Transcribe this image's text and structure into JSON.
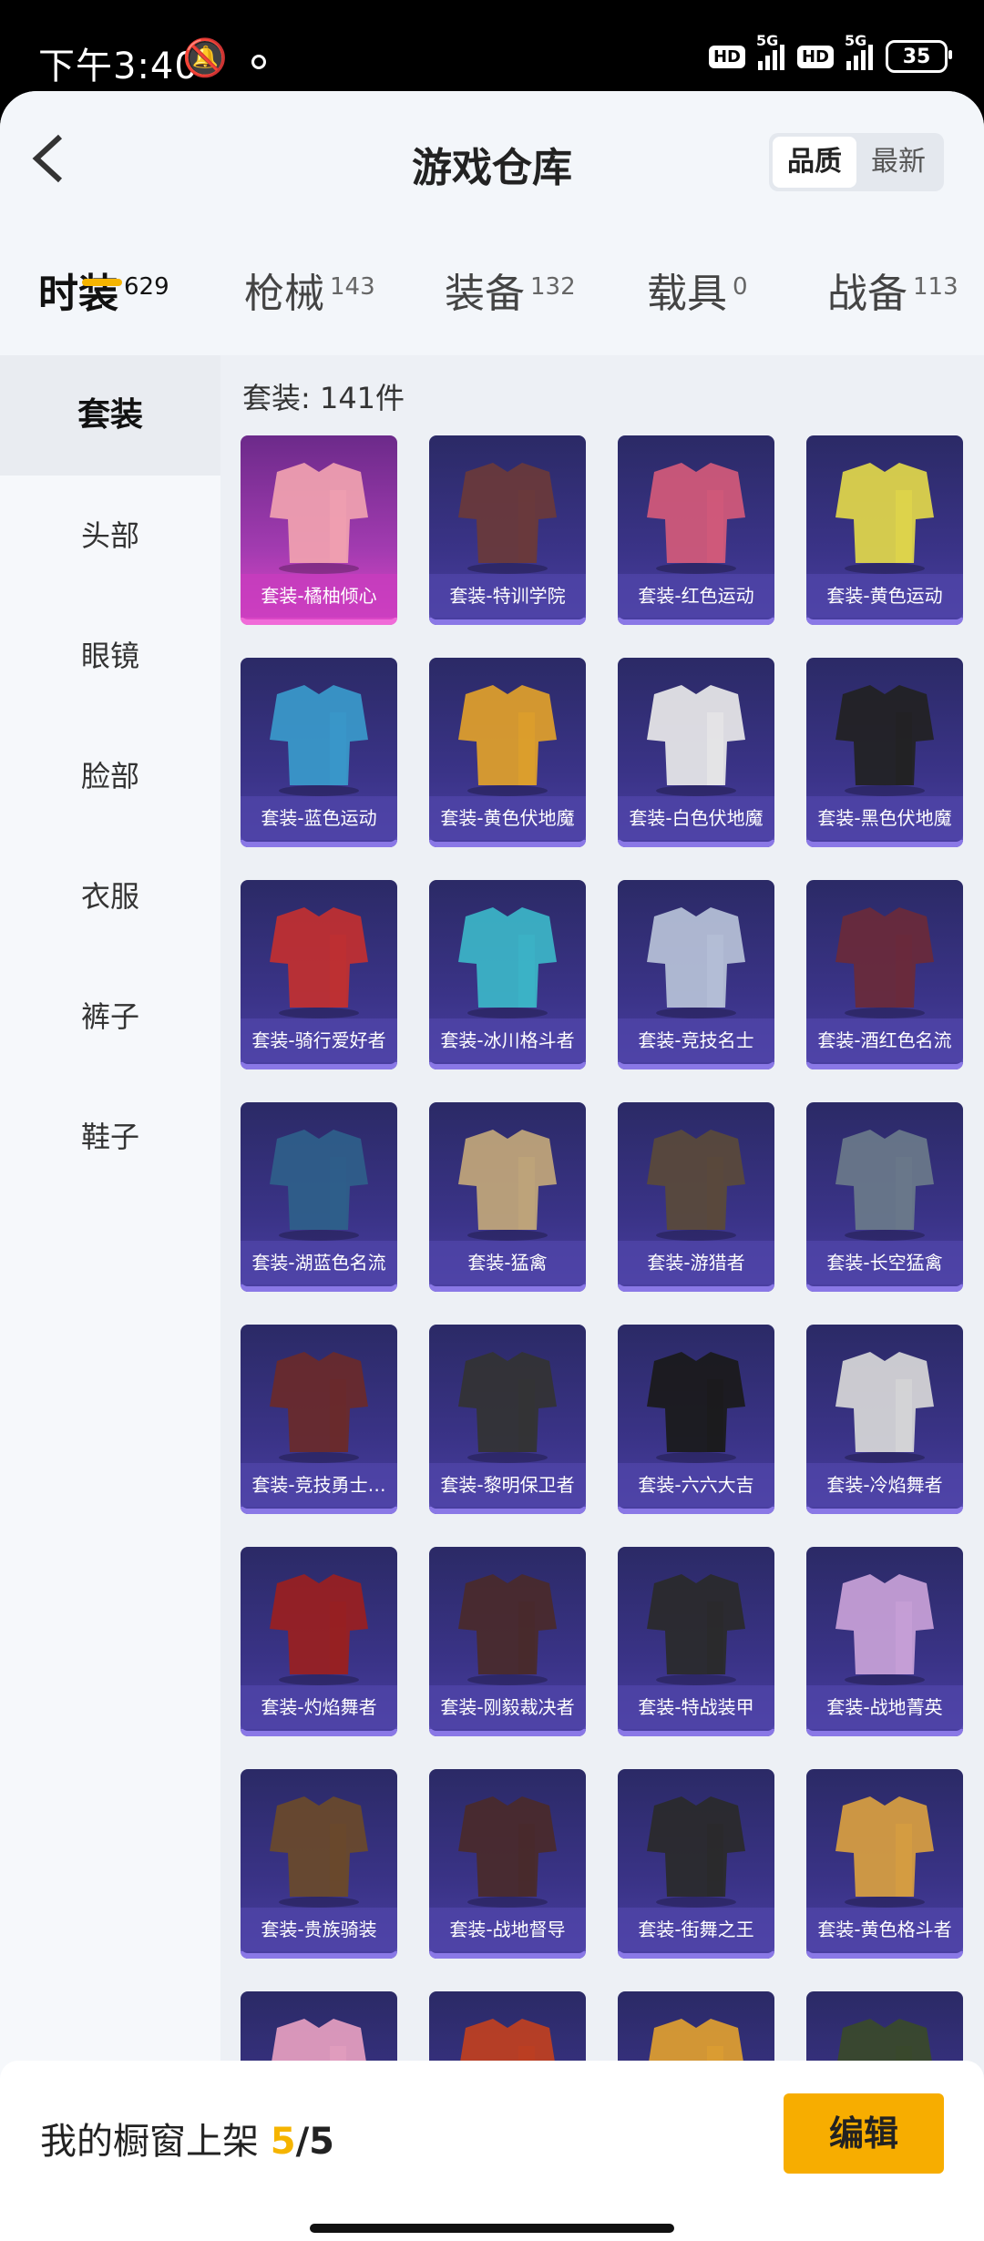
{
  "status": {
    "time": "下午3:40",
    "hd1": "HD",
    "g1": "5G",
    "hd2": "HD",
    "g2": "5G",
    "battery": "35"
  },
  "header": {
    "title": "游戏仓库",
    "sort": [
      "品质",
      "最新"
    ]
  },
  "tabs": [
    {
      "label": "时装",
      "count": "629"
    },
    {
      "label": "枪械",
      "count": "143"
    },
    {
      "label": "装备",
      "count": "132"
    },
    {
      "label": "载具",
      "count": "0"
    },
    {
      "label": "战备",
      "count": "113"
    }
  ],
  "sidebar": [
    "套装",
    "头部",
    "眼镜",
    "脸部",
    "衣服",
    "裤子",
    "鞋子"
  ],
  "content": {
    "count_label": "套装: 141件"
  },
  "items": [
    "套装-橘柚倾心",
    "套装-特训学院",
    "套装-红色运动",
    "套装-黄色运动",
    "套装-蓝色运动",
    "套装-黄色伏地魔",
    "套装-白色伏地魔",
    "套装-黑色伏地魔",
    "套装-骑行爱好者",
    "套装-冰川格斗者",
    "套装-竞技名士",
    "套装-酒红色名流",
    "套装-湖蓝色名流",
    "套装-猛禽",
    "套装-游猎者",
    "套装-长空猛禽",
    "套装-竞技勇士…",
    "套装-黎明保卫者",
    "套装-六六大吉",
    "套装-冷焰舞者",
    "套装-灼焰舞者",
    "套装-刚毅裁决者",
    "套装-特战装甲",
    "套装-战地菁英",
    "套装-贵族骑装",
    "套装-战地督导",
    "套装-街舞之王",
    "套装-黄色格斗者",
    "",
    "",
    "",
    ""
  ],
  "colors": [
    "#f1a2b0",
    "#6a3a3a",
    "#d45a7a",
    "#e2d84a",
    "#3a9acb",
    "#e1a12a",
    "#e9e9e9",
    "#222222",
    "#c23030",
    "#3cb6c8",
    "#b7c2d8",
    "#6a2a3a",
    "#2f5f8a",
    "#c2a77a",
    "#5a4a3a",
    "#6a7a8a",
    "#6a2a2a",
    "#333333",
    "#1a1a1a",
    "#d8d8d8",
    "#9a2020",
    "#4a2a2a",
    "#2a2a2a",
    "#c9a2d8",
    "#6a4a2a",
    "#4a2a2a",
    "#2a2a2a",
    "#d9a040",
    "#e6a0c0",
    "#c04020",
    "#e0a030",
    "#3a4a2a"
  ],
  "bottom": {
    "shelf_label": "我的橱窗上架 ",
    "shelf_used": "5",
    "shelf_total": "/5",
    "edit": "编辑"
  }
}
